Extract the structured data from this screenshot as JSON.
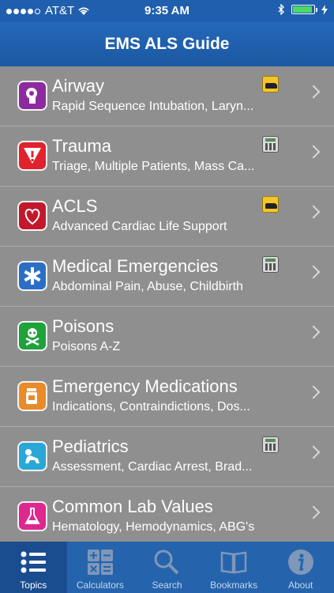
{
  "status": {
    "carrier": "AT&T",
    "time": "9:35 AM"
  },
  "navbar": {
    "title": "EMS ALS Guide"
  },
  "topics": [
    {
      "title": "Airway",
      "subtitle": "Rapid Sequence Intubation, Laryn...",
      "icon": "airway-icon",
      "icon_color": "#8e2aa0",
      "badge": "ambulance-icon"
    },
    {
      "title": "Trauma",
      "subtitle": "Triage, Multiple Patients, Mass Ca...",
      "icon": "warning-icon",
      "icon_color": "#e0222d",
      "badge": "calculator-icon"
    },
    {
      "title": "ACLS",
      "subtitle": "Advanced Cardiac Life Support",
      "icon": "heart-icon",
      "icon_color": "#c3182b",
      "badge": "ambulance-icon"
    },
    {
      "title": "Medical Emergencies",
      "subtitle": "Abdominal Pain, Abuse, Childbirth",
      "icon": "star-of-life-icon",
      "icon_color": "#2a6fc5",
      "badge": "calculator-icon"
    },
    {
      "title": "Poisons",
      "subtitle": "Poisons A-Z",
      "icon": "skull-icon",
      "icon_color": "#1fa23a",
      "badge": ""
    },
    {
      "title": "Emergency Medications",
      "subtitle": "Indications, Contraindictions, Dos...",
      "icon": "pill-bottle-icon",
      "icon_color": "#e98b2a",
      "badge": ""
    },
    {
      "title": "Pediatrics",
      "subtitle": "Assessment, Cardiac Arrest, Brad...",
      "icon": "baby-icon",
      "icon_color": "#29a8d8",
      "badge": "calculator-icon"
    },
    {
      "title": "Common Lab Values",
      "subtitle": "Hematology, Hemodynamics, ABG's",
      "icon": "flask-icon",
      "icon_color": "#e0268f",
      "badge": ""
    }
  ],
  "tabs": [
    {
      "label": "Topics",
      "icon": "list-icon",
      "active": true
    },
    {
      "label": "Calculators",
      "icon": "calculator-icon",
      "active": false
    },
    {
      "label": "Search",
      "icon": "search-icon",
      "active": false
    },
    {
      "label": "Bookmarks",
      "icon": "book-icon",
      "active": false
    },
    {
      "label": "About",
      "icon": "info-icon",
      "active": false
    }
  ]
}
